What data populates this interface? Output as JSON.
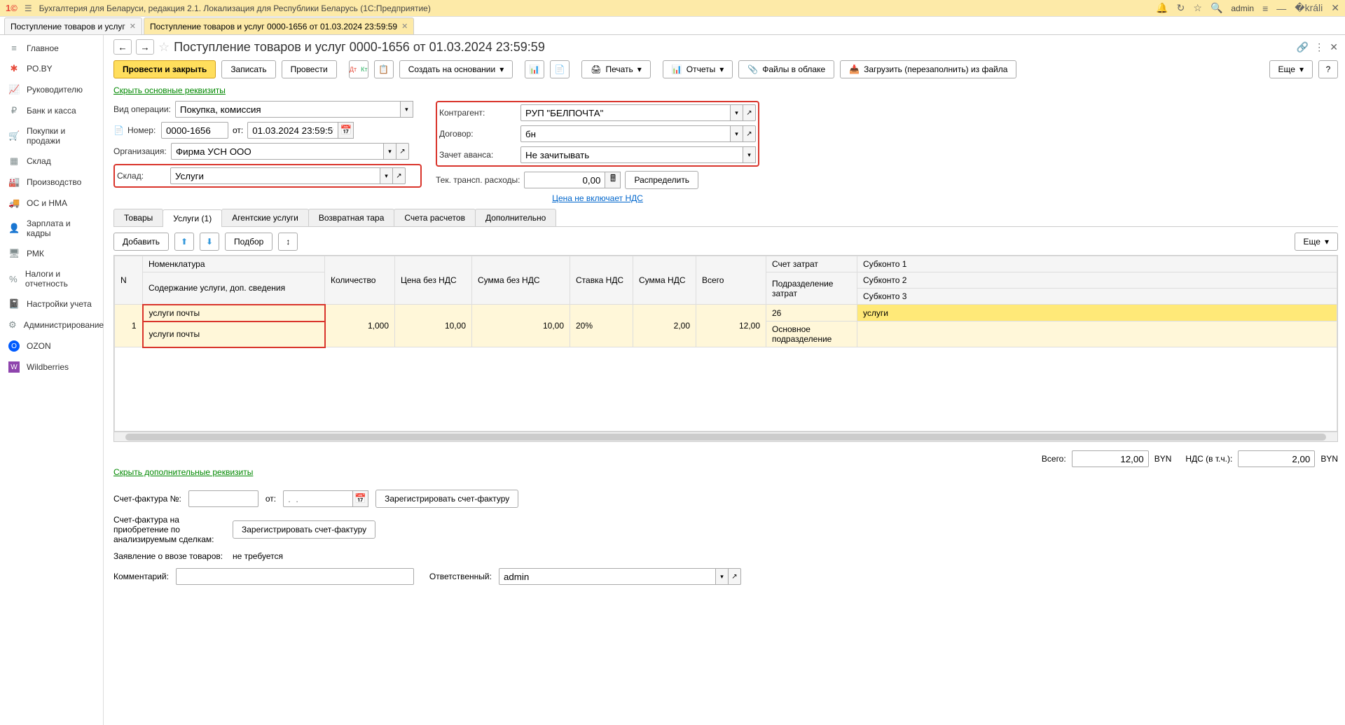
{
  "titlebar": {
    "app_title": "Бухгалтерия для Беларуси, редакция 2.1. Локализация для Республики Беларусь   (1С:Предприятие)",
    "user": "admin"
  },
  "tabs": [
    {
      "label": "Поступление товаров и услуг",
      "active": false
    },
    {
      "label": "Поступление товаров и услуг 0000-1656 от 01.03.2024 23:59:59",
      "active": true
    }
  ],
  "sidebar": {
    "items": [
      {
        "icon": "≡",
        "label": "Главное",
        "color": "ic-gray"
      },
      {
        "icon": "✱",
        "label": "PO.BY",
        "color": "ic-red"
      },
      {
        "icon": "📈",
        "label": "Руководителю",
        "color": "ic-gray"
      },
      {
        "icon": "₽",
        "label": "Банк и касса",
        "color": "ic-gray"
      },
      {
        "icon": "🛒",
        "label": "Покупки и продажи",
        "color": "ic-gray"
      },
      {
        "icon": "▦",
        "label": "Склад",
        "color": "ic-gray"
      },
      {
        "icon": "🏭",
        "label": "Производство",
        "color": "ic-gray"
      },
      {
        "icon": "🚚",
        "label": "ОС и НМА",
        "color": "ic-gray"
      },
      {
        "icon": "👤",
        "label": "Зарплата и кадры",
        "color": "ic-gray"
      },
      {
        "icon": "🖥",
        "label": "РМК",
        "color": "ic-gray"
      },
      {
        "icon": "%",
        "label": "Налоги и отчетность",
        "color": "ic-gray"
      },
      {
        "icon": "📓",
        "label": "Настройки учета",
        "color": "ic-gray"
      },
      {
        "icon": "⚙",
        "label": "Администрирование",
        "color": "ic-gray"
      },
      {
        "icon": "O",
        "label": "OZON",
        "color": "ic-blue"
      },
      {
        "icon": "W",
        "label": "Wildberries",
        "color": "ic-purple"
      }
    ]
  },
  "page": {
    "title": "Поступление товаров и услуг 0000-1656 от 01.03.2024 23:59:59"
  },
  "toolbar": {
    "post_close": "Провести и закрыть",
    "save": "Записать",
    "post": "Провести",
    "create_based": "Создать на основании",
    "print": "Печать",
    "reports": "Отчеты",
    "files": "Файлы в облаке",
    "load_file": "Загрузить (перезаполнить) из файла",
    "more": "Еще"
  },
  "links": {
    "hide_main": "Скрыть основные реквизиты",
    "price_no_vat": "Цена не включает НДС",
    "hide_extra": "Скрыть дополнительные реквизиты"
  },
  "form": {
    "op_type_label": "Вид операции:",
    "op_type": "Покупка, комиссия",
    "number_label": "Номер:",
    "number": "0000-1656",
    "from_label": "от:",
    "date": "01.03.2024 23:59:59",
    "org_label": "Организация:",
    "org": "Фирма УСН ООО",
    "warehouse_label": "Склад:",
    "warehouse": "Услуги",
    "contractor_label": "Контрагент:",
    "contractor": "РУП \"БЕЛПОЧТА\"",
    "contract_label": "Договор:",
    "contract": "бн",
    "advance_label": "Зачет аванса:",
    "advance": "Не зачитывать",
    "transport_label": "Тек. трансп. расходы:",
    "transport": "0,00",
    "distribute": "Распределить"
  },
  "tabpages": [
    {
      "label": "Товары"
    },
    {
      "label": "Услуги (1)"
    },
    {
      "label": "Агентские услуги"
    },
    {
      "label": "Возвратная тара"
    },
    {
      "label": "Счета расчетов"
    },
    {
      "label": "Дополнительно"
    }
  ],
  "table_toolbar": {
    "add": "Добавить",
    "select": "Подбор",
    "more": "Еще"
  },
  "table": {
    "headers": {
      "n": "N",
      "nomenclature": "Номенклатура",
      "content": "Содержание услуги, доп. сведения",
      "qty": "Количество",
      "price": "Цена без НДС",
      "sum": "Сумма без НДС",
      "vat_rate": "Ставка НДС",
      "vat_sum": "Сумма НДС",
      "total": "Всего",
      "cost_acc": "Счет затрат",
      "cost_dept": "Подразделение затрат",
      "sub1": "Субконто 1",
      "sub2": "Субконто 2",
      "sub3": "Субконто 3"
    },
    "rows": [
      {
        "n": "1",
        "nomenclature": "услуги почты",
        "content": "услуги почты",
        "qty": "1,000",
        "price": "10,00",
        "sum": "10,00",
        "vat_rate": "20%",
        "vat_sum": "2,00",
        "total": "12,00",
        "cost_acc": "26",
        "cost_dept": "Основное подразделение",
        "sub1": "услуги"
      }
    ]
  },
  "totals": {
    "total_label": "Всего:",
    "total": "12,00",
    "cur1": "BYN",
    "vat_label": "НДС (в т.ч.):",
    "vat": "2,00",
    "cur2": "BYN"
  },
  "bottom": {
    "invoice_label": "Счет-фактура №:",
    "from2": "от:",
    "date_placeholder": ".  .",
    "register": "Зарегистрировать счет-фактуру",
    "invoice_purchase_label": "Счет-фактура на приобретение по анализируемым сделкам:",
    "register2": "Зарегистрировать счет-фактуру",
    "import_label": "Заявление о ввозе товаров:",
    "import_val": "не требуется",
    "comment_label": "Комментарий:",
    "responsible_label": "Ответственный:",
    "responsible": "admin"
  }
}
